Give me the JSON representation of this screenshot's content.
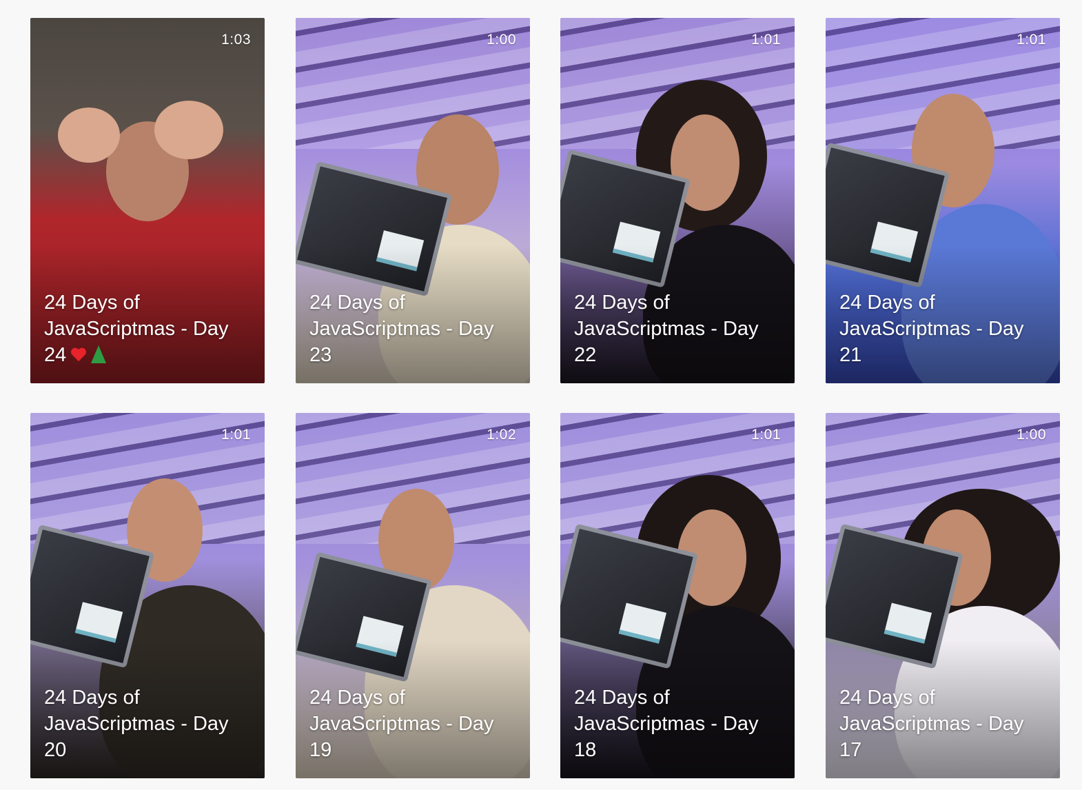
{
  "videos": [
    {
      "duration": "1:03",
      "title_l1": "24 Days of",
      "title_l2": "JavaScriptmas - Day",
      "title_l3": "24",
      "has_emoji": true,
      "bg": "#b5272c",
      "bg2": "#4a4440"
    },
    {
      "duration": "1:00",
      "title_l1": "24 Days of",
      "title_l2": "JavaScriptmas - Day",
      "title_l3": "23",
      "has_emoji": false,
      "bg": "#9a7fd6",
      "bg2": "#d8cdb5"
    },
    {
      "duration": "1:01",
      "title_l1": "24 Days of",
      "title_l2": "JavaScriptmas - Day",
      "title_l3": "22",
      "has_emoji": false,
      "bg": "#9a7fd6",
      "bg2": "#1a1520"
    },
    {
      "duration": "1:01",
      "title_l1": "24 Days of",
      "title_l2": "JavaScriptmas - Day",
      "title_l3": "21",
      "has_emoji": false,
      "bg": "#8c79e0",
      "bg2": "#4d69c9"
    },
    {
      "duration": "1:01",
      "title_l1": "24 Days of",
      "title_l2": "JavaScriptmas - Day",
      "title_l3": "20",
      "has_emoji": false,
      "bg": "#9a86d9",
      "bg2": "#2e2a26"
    },
    {
      "duration": "1:02",
      "title_l1": "24 Days of",
      "title_l2": "JavaScriptmas - Day",
      "title_l3": "19",
      "has_emoji": false,
      "bg": "#9a86d9",
      "bg2": "#d9ccb9"
    },
    {
      "duration": "1:01",
      "title_l1": "24 Days of",
      "title_l2": "JavaScriptmas - Day",
      "title_l3": "18",
      "has_emoji": false,
      "bg": "#9a86d9",
      "bg2": "#17141c"
    },
    {
      "duration": "1:00",
      "title_l1": "24 Days of",
      "title_l2": "JavaScriptmas - Day",
      "title_l3": "17",
      "has_emoji": false,
      "bg": "#9a86d9",
      "bg2": "#e9e6ef"
    }
  ]
}
